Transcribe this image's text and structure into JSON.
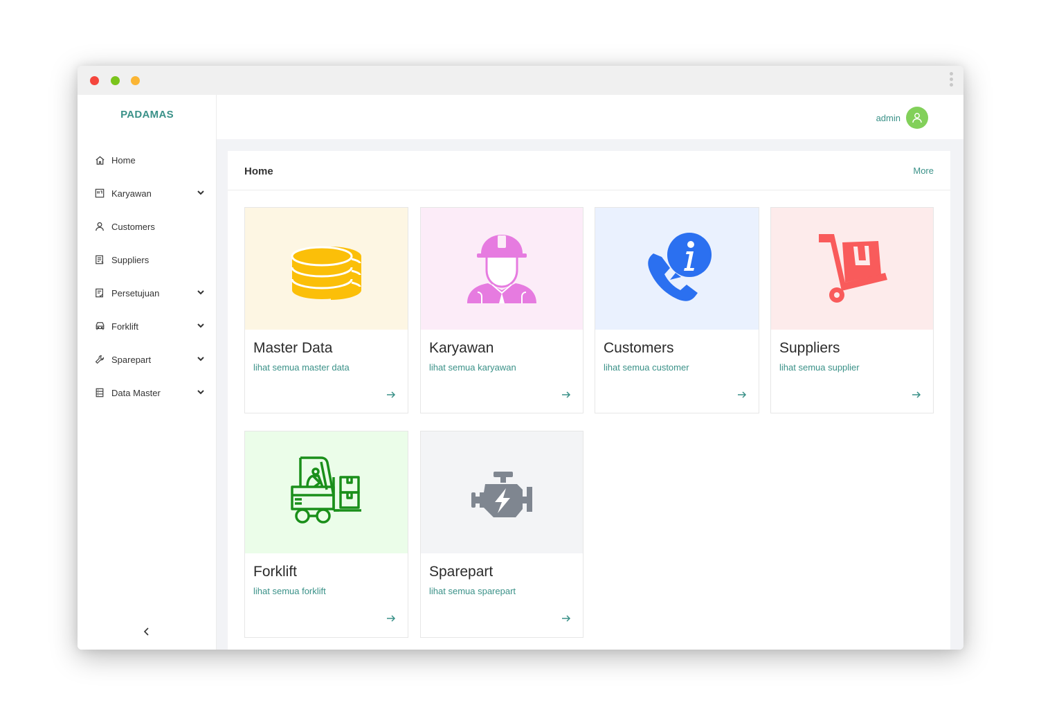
{
  "app": {
    "brand": "PADAMAS"
  },
  "user": {
    "name": "admin"
  },
  "sidebar": {
    "items": [
      {
        "label": "Home",
        "icon": "home-icon",
        "expandable": false
      },
      {
        "label": "Karyawan",
        "icon": "id-card-icon",
        "expandable": true
      },
      {
        "label": "Customers",
        "icon": "user-icon",
        "expandable": false
      },
      {
        "label": "Suppliers",
        "icon": "document-icon",
        "expandable": false
      },
      {
        "label": "Persetujuan",
        "icon": "approval-doc-icon",
        "expandable": true
      },
      {
        "label": "Forklift",
        "icon": "vehicle-icon",
        "expandable": true
      },
      {
        "label": "Sparepart",
        "icon": "wrench-icon",
        "expandable": true
      },
      {
        "label": "Data Master",
        "icon": "database-icon",
        "expandable": true
      }
    ]
  },
  "panel": {
    "title": "Home",
    "more": "More"
  },
  "cards": [
    {
      "title": "Master Data",
      "subtitle": "lihat semua master data",
      "icon": "database-stack-icon",
      "bg": "#fdf6e3",
      "accent": "#fbbf09"
    },
    {
      "title": "Karyawan",
      "subtitle": "lihat semua karyawan",
      "icon": "worker-icon",
      "bg": "#fcecf8",
      "accent": "#e67be0"
    },
    {
      "title": "Customers",
      "subtitle": "lihat semua customer",
      "icon": "phone-info-icon",
      "bg": "#eaf1fe",
      "accent": "#2b70f0"
    },
    {
      "title": "Suppliers",
      "subtitle": "lihat semua supplier",
      "icon": "hand-truck-icon",
      "bg": "#fdebeb",
      "accent": "#f95b5b"
    },
    {
      "title": "Forklift",
      "subtitle": "lihat semua forklift",
      "icon": "forklift-icon",
      "bg": "#ebfde9",
      "accent": "#1a8f1a"
    },
    {
      "title": "Sparepart",
      "subtitle": "lihat semua sparepart",
      "icon": "engine-icon",
      "bg": "#f3f4f6",
      "accent": "#7f8690"
    }
  ],
  "colors": {
    "teal": "#3a9188",
    "avatar": "#82d05a"
  }
}
